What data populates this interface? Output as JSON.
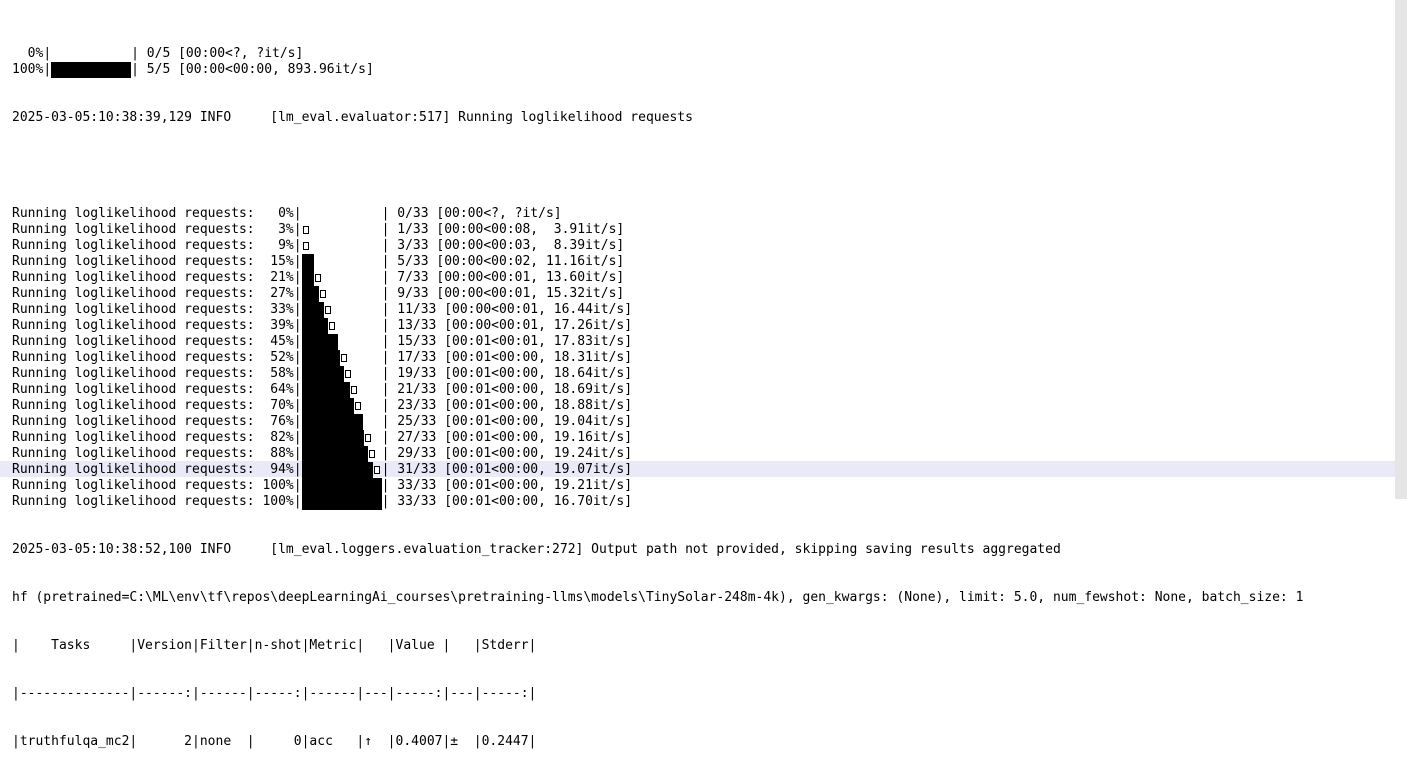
{
  "terminal": {
    "top_lines": [
      {
        "pct": "  0%",
        "filled": 0.0,
        "partial": false,
        "stats": "| 0/5 [00:00<?, ?it/s]"
      },
      {
        "pct": "100%",
        "filled": 1.0,
        "partial": false,
        "stats": "| 5/5 [00:00<00:00, 893.96it/s]"
      }
    ],
    "log1": "2025-03-05:10:38:39,129 INFO     [lm_eval.evaluator:517] Running loglikelihood requests",
    "progress_prefix": "Running loglikelihood requests: ",
    "progress": [
      {
        "pct": "  0%",
        "filled": 0.0,
        "partial": false,
        "stats": "| 0/33 [00:00<?, ?it/s]"
      },
      {
        "pct": "  3%",
        "filled": 0.0,
        "partial": true,
        "stats": "| 1/33 [00:00<00:08,  3.91it/s]"
      },
      {
        "pct": "  9%",
        "filled": 0.0,
        "partial": true,
        "stats": "| 3/33 [00:00<00:03,  8.39it/s]"
      },
      {
        "pct": " 15%",
        "filled": 0.15,
        "partial": false,
        "stats": "| 5/33 [00:00<00:02, 11.16it/s]"
      },
      {
        "pct": " 21%",
        "filled": 0.15,
        "partial": true,
        "stats": "| 7/33 [00:00<00:01, 13.60it/s]"
      },
      {
        "pct": " 27%",
        "filled": 0.21,
        "partial": true,
        "stats": "| 9/33 [00:00<00:01, 15.32it/s]"
      },
      {
        "pct": " 33%",
        "filled": 0.27,
        "partial": true,
        "stats": "| 11/33 [00:00<00:01, 16.44it/s]"
      },
      {
        "pct": " 39%",
        "filled": 0.33,
        "partial": true,
        "stats": "| 13/33 [00:00<00:01, 17.26it/s]"
      },
      {
        "pct": " 45%",
        "filled": 0.45,
        "partial": false,
        "stats": "| 15/33 [00:01<00:01, 17.83it/s]"
      },
      {
        "pct": " 52%",
        "filled": 0.48,
        "partial": true,
        "stats": "| 17/33 [00:01<00:00, 18.31it/s]"
      },
      {
        "pct": " 58%",
        "filled": 0.52,
        "partial": true,
        "stats": "| 19/33 [00:01<00:00, 18.64it/s]"
      },
      {
        "pct": " 64%",
        "filled": 0.6,
        "partial": true,
        "stats": "| 21/33 [00:01<00:00, 18.69it/s]"
      },
      {
        "pct": " 70%",
        "filled": 0.65,
        "partial": true,
        "stats": "| 23/33 [00:01<00:00, 18.88it/s]"
      },
      {
        "pct": " 76%",
        "filled": 0.76,
        "partial": false,
        "stats": "| 25/33 [00:01<00:00, 19.04it/s]"
      },
      {
        "pct": " 82%",
        "filled": 0.78,
        "partial": true,
        "stats": "| 27/33 [00:01<00:00, 19.16it/s]"
      },
      {
        "pct": " 88%",
        "filled": 0.83,
        "partial": true,
        "stats": "| 29/33 [00:01<00:00, 19.24it/s]"
      },
      {
        "pct": " 94%",
        "filled": 0.89,
        "partial": true,
        "stats": "| 31/33 [00:01<00:00, 19.07it/s]"
      },
      {
        "pct": "100%",
        "filled": 1.0,
        "partial": false,
        "stats": "| 33/33 [00:01<00:00, 19.21it/s]"
      },
      {
        "pct": "100%",
        "filled": 1.0,
        "partial": false,
        "stats": "| 33/33 [00:01<00:00, 16.70it/s]"
      }
    ],
    "log2": "2025-03-05:10:38:52,100 INFO     [lm_eval.loggers.evaluation_tracker:272] Output path not provided, skipping saving results aggregated",
    "hf_line": "hf (pretrained=C:\\ML\\env\\tf\\repos\\deepLearningAi_courses\\pretraining-llms\\models\\TinySolar-248m-4k), gen_kwargs: (None), limit: 5.0, num_fewshot: None, batch_size: 1",
    "table": {
      "header": "|    Tasks     |Version|Filter|n-shot|Metric|   |Value |   |Stderr|",
      "separator": "|--------------|------:|------|-----:|------|---|-----:|---|-----:|",
      "row": "|truthfulqa_mc2|      2|none  |     0|acc   |↑  |0.4007|±  |0.2447|"
    }
  }
}
